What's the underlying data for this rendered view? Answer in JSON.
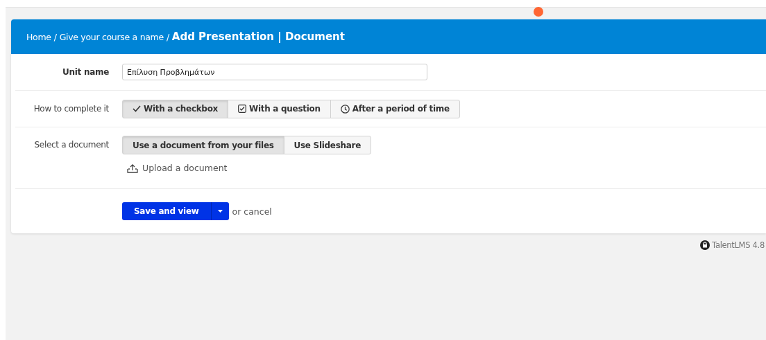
{
  "header": {
    "breadcrumbs": [
      "Home",
      "Give your course a name"
    ],
    "separator": "/",
    "title": "Add Presentation | Document"
  },
  "unit_name": {
    "label": "Unit name",
    "value": "Επίλυση Προβλημάτων"
  },
  "completion": {
    "label": "How to complete it",
    "options": [
      {
        "label": "With a checkbox",
        "kind": "check",
        "selected": true
      },
      {
        "label": "With a question",
        "kind": "checkbox",
        "selected": false
      },
      {
        "label": "After a period of time",
        "kind": "clock",
        "selected": false
      }
    ]
  },
  "document": {
    "label": "Select a document",
    "options": [
      {
        "label": "Use a document from your files",
        "selected": true
      },
      {
        "label": "Use Slideshare",
        "selected": false
      }
    ],
    "upload": "Upload a document"
  },
  "actions": {
    "save": "Save and view",
    "cancel": "or cancel"
  },
  "footer": {
    "version": "TalentLMS 4.8"
  }
}
